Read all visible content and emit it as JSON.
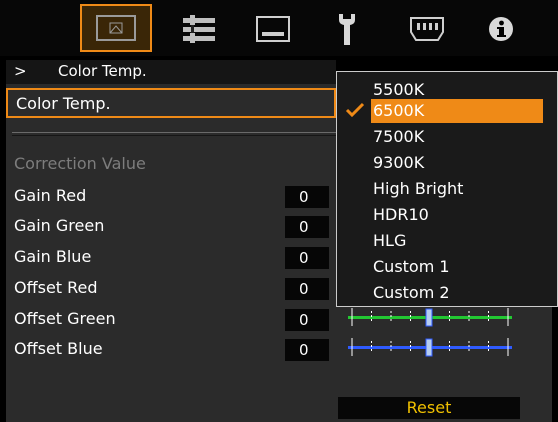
{
  "tabs": [
    {
      "name": "picture-tab",
      "icon": "picture-icon",
      "active": true
    },
    {
      "name": "settings-tab",
      "icon": "sliders-icon",
      "active": false
    },
    {
      "name": "display-tab",
      "icon": "display-icon",
      "active": false
    },
    {
      "name": "install-tab",
      "icon": "wrench-icon",
      "active": false
    },
    {
      "name": "function-tab",
      "icon": "connector-icon",
      "active": false
    },
    {
      "name": "info-tab",
      "icon": "info-icon",
      "active": false
    }
  ],
  "breadcrumb": {
    "arrow": ">",
    "title": "Color Temp."
  },
  "selected_setting": {
    "label": "Color Temp."
  },
  "section_title": "Correction Value",
  "rows": [
    {
      "label": "Gain Red",
      "value": "0",
      "color": "#e02020"
    },
    {
      "label": "Gain Green",
      "value": "0",
      "color": "#22c832"
    },
    {
      "label": "Gain Blue",
      "value": "0",
      "color": "#2f5bff"
    },
    {
      "label": "Offset Red",
      "value": "0",
      "color": "#e02020"
    },
    {
      "label": "Offset Green",
      "value": "0",
      "color": "#22c832"
    },
    {
      "label": "Offset Blue",
      "value": "0",
      "color": "#2f5bff"
    }
  ],
  "dropdown": {
    "options": [
      "5500K",
      "6500K",
      "7500K",
      "9300K",
      "High Bright",
      "HDR10",
      "HLG",
      "Custom 1",
      "Custom 2"
    ],
    "selected": "6500K"
  },
  "reset_label": "Reset",
  "accent_color": "#ef8a17"
}
